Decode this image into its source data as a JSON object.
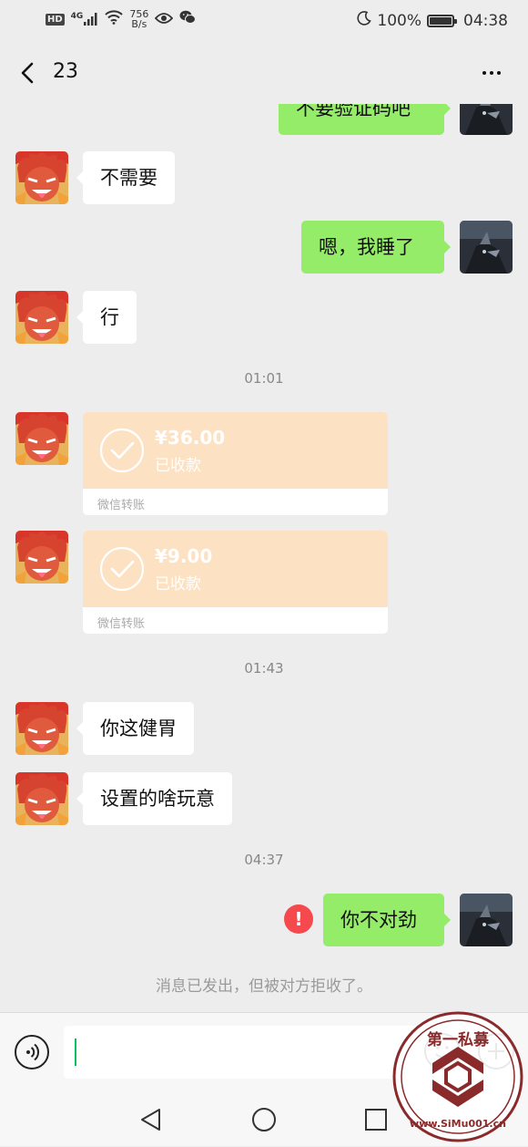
{
  "status_bar": {
    "hd": "HD",
    "network": "4G",
    "speed_value": "756",
    "speed_unit": "B/s",
    "battery": "100%",
    "battery_level": 1.0,
    "time": "04:38"
  },
  "header": {
    "title": "23"
  },
  "messages": {
    "m0": "不要验证码吧",
    "m1": "不需要",
    "m2": "嗯，我睡了",
    "m3": "行",
    "t1": "01:01",
    "transfer1": {
      "amount": "¥36.00",
      "status": "已收款",
      "footer": "微信转账"
    },
    "transfer2": {
      "amount": "¥9.00",
      "status": "已收款",
      "footer": "微信转账"
    },
    "t2": "01:43",
    "m4": "你这健胃",
    "m5": "设置的啥玩意",
    "t3": "04:37",
    "m6": "你不对劲",
    "error_mark": "!",
    "system": "消息已发出，但被对方拒收了。"
  },
  "watermark": {
    "top_text": "第一私募",
    "bottom_text": "www.SiMu001.cn"
  },
  "colors": {
    "background": "#ededed",
    "bubble_self": "#95ec69",
    "bubble_other": "#ffffff",
    "transfer": "#fde1c3",
    "error": "#f5494d",
    "watermark": "#8b2a2a"
  }
}
